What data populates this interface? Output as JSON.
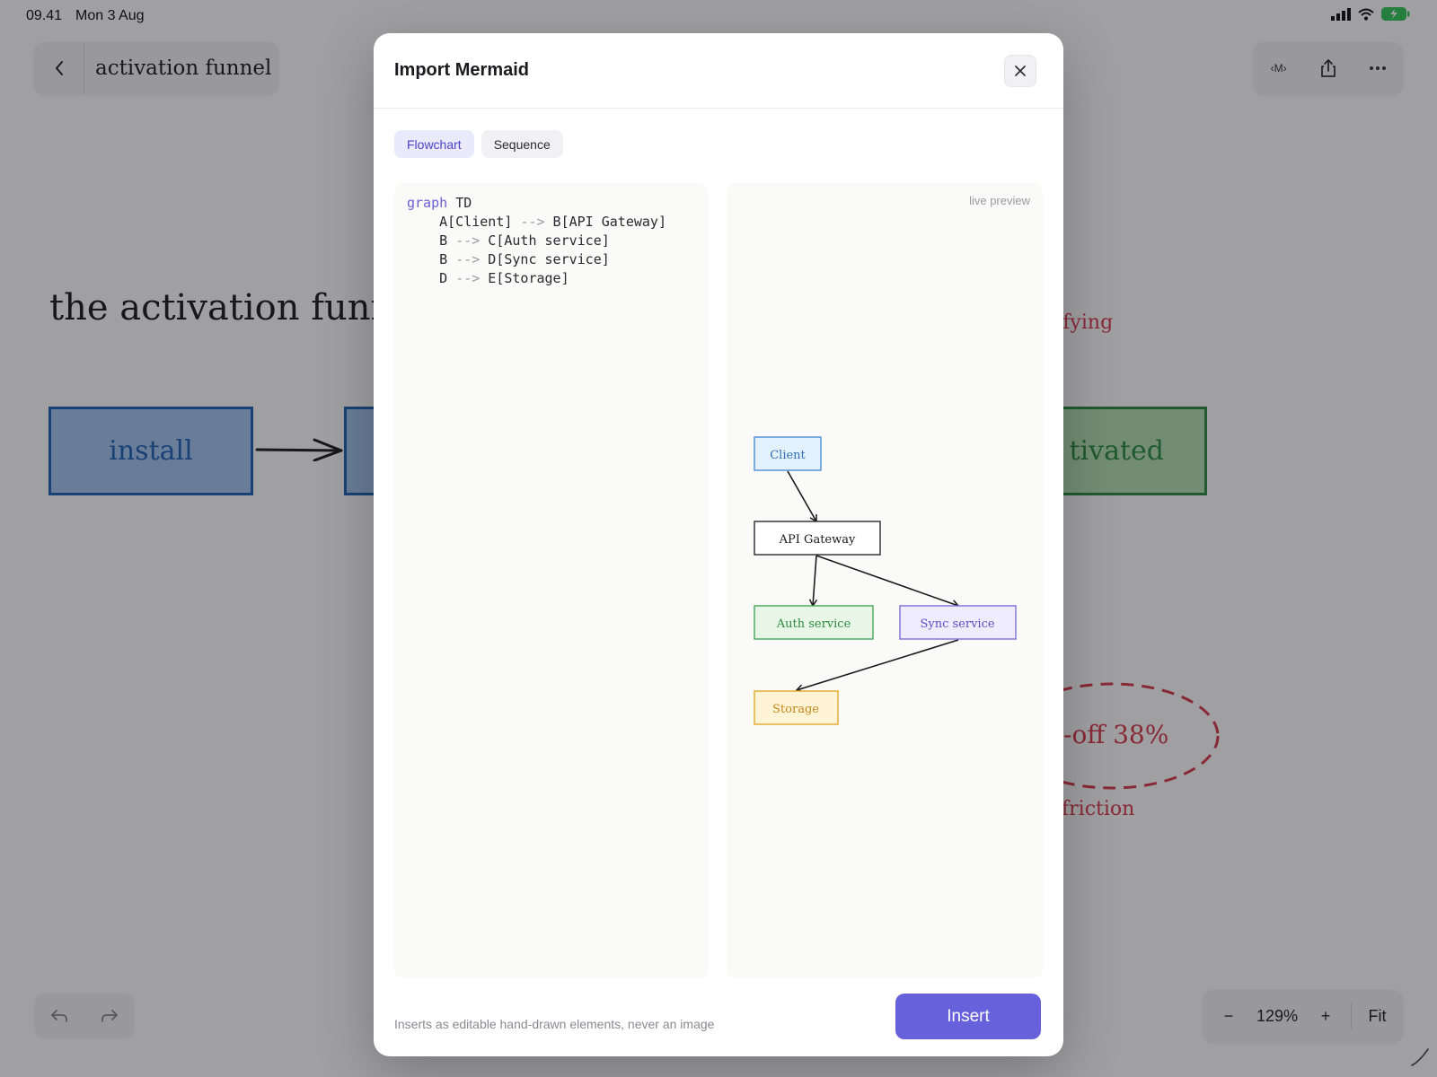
{
  "status_bar": {
    "time": "09.41",
    "date": "Mon 3 Aug"
  },
  "canvas": {
    "document_title": "activation funnel",
    "heading": "the activation funn",
    "nodes": {
      "install": "install",
      "activated": "tivated"
    },
    "notes": {
      "satisfying": "sfying",
      "dropoff": "-off 38%",
      "friction": "friction"
    },
    "toolbar": {
      "markdown_button": "‹M›"
    },
    "zoom": {
      "minus_label": "−",
      "level": "129%",
      "plus_label": "+",
      "fit_label": "Fit"
    },
    "colors": {
      "install_fill": "#a3c5ee",
      "install_stroke": "#1e62b5",
      "activated_fill": "#b5e0b3",
      "activated_stroke": "#2b8a3e",
      "annotation": "#d8394b"
    }
  },
  "modal": {
    "title": "Import Mermaid",
    "tabs": [
      {
        "label": "Flowchart",
        "active": true
      },
      {
        "label": "Sequence",
        "active": false
      }
    ],
    "code": {
      "keyword": "graph",
      "direction": "TD",
      "lines": [
        {
          "left": "    A[Client] ",
          "arrow": "-->",
          "right": " B[API Gateway]"
        },
        {
          "left": "    B ",
          "arrow": "-->",
          "right": " C[Auth service]"
        },
        {
          "left": "    B ",
          "arrow": "-->",
          "right": " D[Sync service]"
        },
        {
          "left": "    D ",
          "arrow": "-->",
          "right": " E[Storage]"
        }
      ]
    },
    "preview": {
      "label": "live preview",
      "nodes": [
        {
          "id": "A",
          "label": "Client",
          "fill": "#e3f1fd",
          "stroke": "#4a8fd6",
          "text": "#2f6fb8"
        },
        {
          "id": "B",
          "label": "API Gateway",
          "fill": "#ffffff",
          "stroke": "#2a2a30",
          "text": "#1b1b1f"
        },
        {
          "id": "C",
          "label": "Auth service",
          "fill": "#e7f6e7",
          "stroke": "#4aa55a",
          "text": "#2f8a3f"
        },
        {
          "id": "D",
          "label": "Sync service",
          "fill": "#efedfd",
          "stroke": "#7a70d9",
          "text": "#5a50c0"
        },
        {
          "id": "E",
          "label": "Storage",
          "fill": "#fff4d6",
          "stroke": "#e0a92a",
          "text": "#c4871a"
        }
      ]
    },
    "footnote": "Inserts as editable hand-drawn elements, never an image",
    "insert_label": "Insert",
    "accent": "#6761dc"
  }
}
